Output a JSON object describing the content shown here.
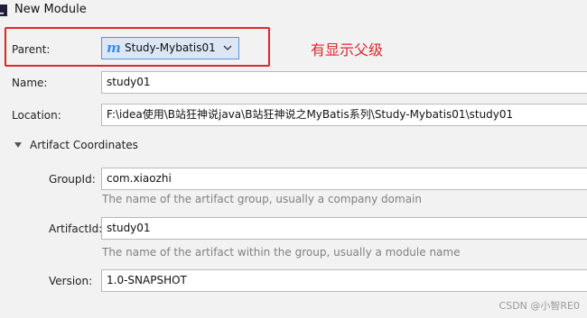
{
  "window": {
    "title": "New Module",
    "app_icon": "intellij-icon"
  },
  "parent": {
    "label": "Parent:",
    "icon": "maven-m-icon",
    "value": "Study-Mybatis01",
    "annotation": "有显示父级",
    "highlight_color": "#e0262c"
  },
  "name": {
    "label": "Name:",
    "value": "study01"
  },
  "location": {
    "label": "Location:",
    "value": "F:\\idea使用\\B站狂神说java\\B站狂神说之MyBatis系列\\Study-Mybatis01\\study01"
  },
  "artifact": {
    "section_label": "Artifact Coordinates",
    "expanded": true,
    "group_id": {
      "label": "GroupId:",
      "value": "com.xiaozhi",
      "hint": "The name of the artifact group, usually a company domain"
    },
    "artifact_id": {
      "label": "ArtifactId:",
      "value": "study01",
      "hint": "The name of the artifact within the group, usually a module name"
    },
    "version": {
      "label": "Version:",
      "value": "1.0-SNAPSHOT"
    }
  },
  "watermark": "CSDN @小智RE0"
}
